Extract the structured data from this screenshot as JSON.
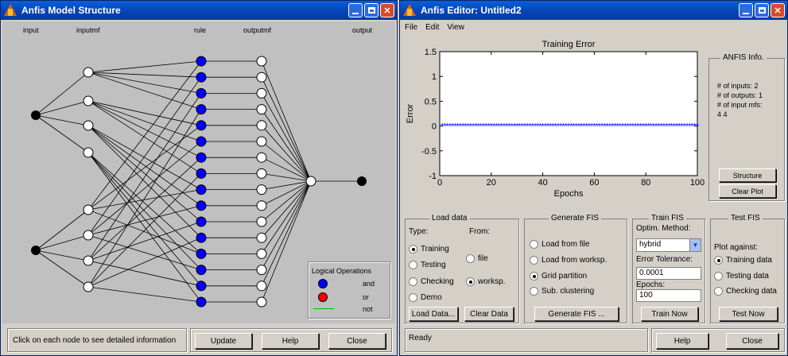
{
  "win1": {
    "title": "Anfis Model Structure",
    "layers": [
      "input",
      "inputmf",
      "rule",
      "outputmf",
      "output"
    ],
    "legend": {
      "title": "Logical Operations",
      "items": [
        {
          "label": "and",
          "color": "#0000ff"
        },
        {
          "label": "or",
          "color": "#ff0000"
        },
        {
          "label": "not",
          "color": "#00c000"
        }
      ]
    },
    "status": "Click on each node to see detailed information",
    "buttons": {
      "update": "Update",
      "help": "Help",
      "close": "Close"
    }
  },
  "win2": {
    "title": "Anfis Editor: Untitled2",
    "menu": [
      "File",
      "Edit",
      "View"
    ],
    "plot": {
      "title": "Training Error",
      "ylabel": "Error",
      "xlabel": "Epochs"
    },
    "info": {
      "title": "ANFIS Info.",
      "lines": [
        "# of inputs: 2",
        "# of outputs: 1",
        "# of input mfs:",
        "4 4"
      ],
      "structure": "Structure",
      "clear": "Clear Plot"
    },
    "load": {
      "title": "Load data",
      "type_label": "Type:",
      "from_label": "From:",
      "types": [
        "Training",
        "Testing",
        "Checking",
        "Demo"
      ],
      "from": [
        "file",
        "worksp."
      ],
      "load_btn": "Load Data...",
      "clear_btn": "Clear Data"
    },
    "gen": {
      "title": "Generate FIS",
      "options": [
        "Load from file",
        "Load from worksp.",
        "Grid partition",
        "Sub. clustering"
      ],
      "btn": "Generate FIS ..."
    },
    "train": {
      "title": "Train FIS",
      "method_label": "Optim. Method:",
      "method": "hybrid",
      "tol_label": "Error Tolerance:",
      "tol": "0.0001",
      "epochs_label": "Epochs:",
      "epochs": "100",
      "btn": "Train Now"
    },
    "test": {
      "title": "Test FIS",
      "against": "Plot against:",
      "options": [
        "Training data",
        "Testing data",
        "Checking data"
      ],
      "btn": "Test Now"
    },
    "status": "Ready",
    "help": "Help",
    "close": "Close"
  },
  "chart_data": {
    "type": "line",
    "title": "Training Error",
    "xlabel": "Epochs",
    "ylabel": "Error",
    "xlim": [
      0,
      100
    ],
    "ylim": [
      -1,
      1.5
    ],
    "xticks": [
      0,
      20,
      40,
      60,
      80,
      100
    ],
    "yticks": [
      -1,
      -0.5,
      0,
      0.5,
      1,
      1.5
    ],
    "series": [
      {
        "marker": "*",
        "color": "#0000ff",
        "x_start": 1,
        "x_end": 100,
        "value": 0
      }
    ]
  }
}
